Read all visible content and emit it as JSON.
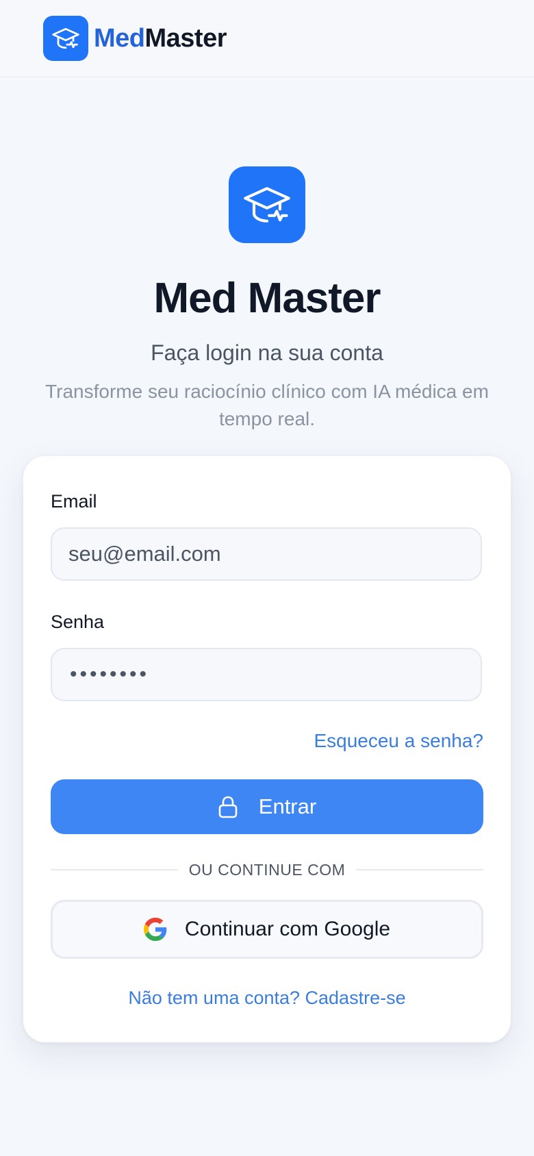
{
  "header": {
    "brand_part1": "Med",
    "brand_part2": "Master",
    "logo_icon": "graduation-cap-pulse-icon"
  },
  "hero": {
    "title": "Med Master",
    "subtitle": "Faça login na sua conta",
    "description": "Transforme seu raciocínio clínico com IA médica em tempo real."
  },
  "form": {
    "email_label": "Email",
    "email_placeholder": "seu@email.com",
    "password_label": "Senha",
    "password_value": "••••••••",
    "forgot_link": "Esqueceu a senha?",
    "submit_label": "Entrar",
    "submit_icon": "lock-icon",
    "divider_text": "OU CONTINUE COM",
    "google_label": "Continuar com Google",
    "signup_text": "Não tem uma conta? Cadastre-se"
  },
  "colors": {
    "brand_blue": "#1f74f7",
    "button_blue": "#3f86f5",
    "link_blue": "#3b7ddd",
    "background": "#f4f7fc"
  }
}
